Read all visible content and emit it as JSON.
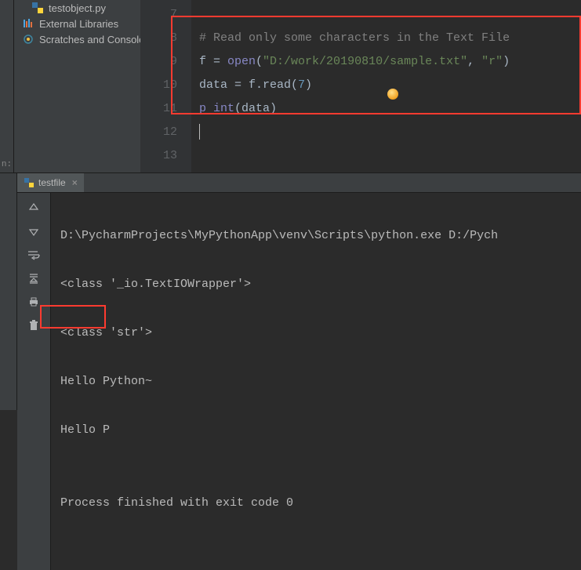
{
  "tree": {
    "item_file": "testobject.py",
    "item_libs": "External Libraries",
    "item_scratch": "Scratches and Consoles"
  },
  "gutter": [
    "7",
    "8",
    "9",
    "10",
    "11",
    "12",
    "13"
  ],
  "code": {
    "comment": "# Read only some characters in the Text File",
    "l9_a": "f = ",
    "l9_open": "open",
    "l9_b": "(",
    "l9_str1": "\"D:/work/20190810/sample.txt\"",
    "l9_c": ", ",
    "l9_str2": "\"r\"",
    "l9_d": ")",
    "l10_a": "data = f.read(",
    "l10_num": "7",
    "l10_b": ")",
    "l11_a": "p",
    "l11_b": "int",
    "l11_c": "(data)"
  },
  "tool": {
    "side_label": "n:",
    "tab_name": "testfile",
    "out1": "D:\\PycharmProjects\\MyPythonApp\\venv\\Scripts\\python.exe D:/Pych",
    "out2": "<class '_io.TextIOWrapper'>",
    "out3": "<class 'str'>",
    "out4": "Hello Python~",
    "out5": "Hello P",
    "out_blank": "",
    "out6": "Process finished with exit code 0"
  }
}
